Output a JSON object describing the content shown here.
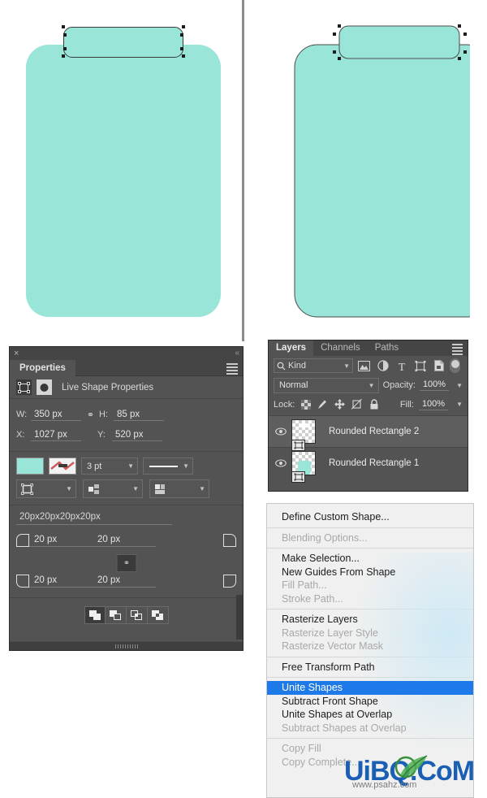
{
  "canvas": {
    "shape_fill_color": "#99e5d7",
    "background_color": "#ffffff",
    "left_pane_name": "before-unite-canvas",
    "right_pane_name": "after-unite-canvas"
  },
  "properties_panel": {
    "title": "Properties",
    "close_label": "×",
    "collapse_label": "«",
    "shape_header_label": "Live Shape Properties",
    "fields": {
      "w_label": "W:",
      "w_value": "350 px",
      "h_label": "H:",
      "h_value": "85 px",
      "x_label": "X:",
      "x_value": "1027 px",
      "y_label": "Y:",
      "y_value": "520 px",
      "link_icon_label": "∞"
    },
    "stroke": {
      "fill_color": "#99e5d7",
      "weight_value": "3 pt",
      "stroke_style_label": "———"
    },
    "radius": {
      "summary": "20px20px20px20px",
      "top_left": "20 px",
      "top_right": "20 px",
      "bottom_left": "20 px",
      "bottom_right": "20 px",
      "link_label": "∞"
    }
  },
  "layers_panel": {
    "tabs": [
      {
        "label": "Layers",
        "active": true
      },
      {
        "label": "Channels",
        "active": false
      },
      {
        "label": "Paths",
        "active": false
      }
    ],
    "filter": {
      "kind_label": "Kind",
      "search_icon": "search-icon"
    },
    "blend": {
      "mode": "Normal",
      "opacity_label": "Opacity:",
      "opacity_value": "100%"
    },
    "lock": {
      "label": "Lock:",
      "fill_label": "Fill:",
      "fill_value": "100%"
    },
    "layers": [
      {
        "name": "Rounded Rectangle 2",
        "visible": true,
        "selected": true,
        "thumb_color": "#ffffff"
      },
      {
        "name": "Rounded Rectangle 1",
        "visible": true,
        "selected": false,
        "thumb_color": "#99e5d7"
      }
    ]
  },
  "context_menu": {
    "items": [
      {
        "label": "Define Custom Shape...",
        "state": "normal"
      },
      {
        "label": "__SEP__",
        "state": "sep"
      },
      {
        "label": "Blending Options...",
        "state": "disabled"
      },
      {
        "label": "__SEP__",
        "state": "sep"
      },
      {
        "label": "Make Selection...",
        "state": "normal"
      },
      {
        "label": "New Guides From Shape",
        "state": "normal"
      },
      {
        "label": "Fill Path...",
        "state": "disabled"
      },
      {
        "label": "Stroke Path...",
        "state": "disabled"
      },
      {
        "label": "__SEP__",
        "state": "sep"
      },
      {
        "label": "Rasterize Layers",
        "state": "normal"
      },
      {
        "label": "Rasterize Layer Style",
        "state": "disabled"
      },
      {
        "label": "Rasterize Vector Mask",
        "state": "disabled"
      },
      {
        "label": "__SEP__",
        "state": "sep"
      },
      {
        "label": "Free Transform Path",
        "state": "normal"
      },
      {
        "label": "__SEP__",
        "state": "sep"
      },
      {
        "label": "Unite Shapes",
        "state": "highlight"
      },
      {
        "label": "Subtract Front Shape",
        "state": "normal"
      },
      {
        "label": "Unite Shapes at Overlap",
        "state": "normal"
      },
      {
        "label": "Subtract Shapes at Overlap",
        "state": "disabled"
      },
      {
        "label": "__SEP__",
        "state": "sep"
      },
      {
        "label": "Copy Fill",
        "state": "disabled"
      },
      {
        "label": "Copy Complete...",
        "state": "disabled"
      }
    ]
  },
  "watermark": {
    "text": "UiBQ.CoM",
    "subtext": "www.psahz.com",
    "color": "#1a5fb4"
  }
}
